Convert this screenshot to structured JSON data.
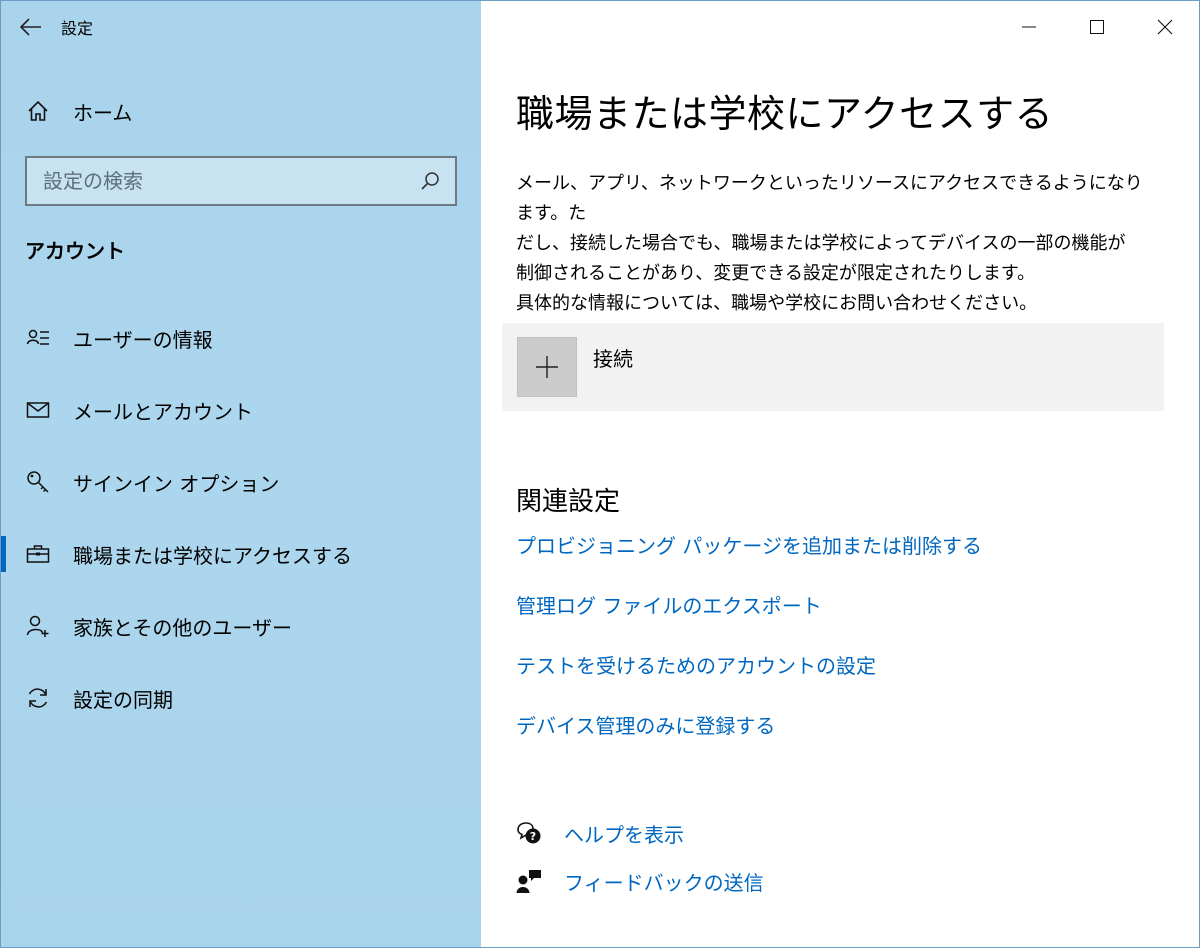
{
  "window": {
    "title": "設定"
  },
  "sidebar": {
    "home_label": "ホーム",
    "search_placeholder": "設定の検索",
    "section_title": "アカウント",
    "items": [
      {
        "label": "ユーザーの情報",
        "icon": "user-info-icon"
      },
      {
        "label": "メールとアカウント",
        "icon": "mail-icon"
      },
      {
        "label": "サインイン オプション",
        "icon": "key-icon"
      },
      {
        "label": "職場または学校にアクセスする",
        "icon": "briefcase-icon",
        "active": true
      },
      {
        "label": "家族とその他のユーザー",
        "icon": "add-user-icon"
      },
      {
        "label": "設定の同期",
        "icon": "sync-icon"
      }
    ],
    "accent_color": "#0067c0",
    "background_color": "#aad5ec"
  },
  "main": {
    "title": "職場または学校にアクセスする",
    "description_lines": [
      "メール、アプリ、ネットワークといったリソースにアクセスできるようになります。た",
      "だし、接続した場合でも、職場または学校によってデバイスの一部の機能が",
      "制御されることがあり、変更できる設定が限定されたりします。",
      "具体的な情報については、職場や学校にお問い合わせください。"
    ],
    "connect_label": "接続",
    "related_title": "関連設定",
    "related_links": [
      "プロビジョニング パッケージを追加または削除する",
      "管理ログ ファイルのエクスポート",
      "テストを受けるためのアカウントの設定",
      "デバイス管理のみに登録する"
    ],
    "help_label": "ヘルプを表示",
    "feedback_label": "フィードバックの送信",
    "link_color": "#0067c0"
  }
}
